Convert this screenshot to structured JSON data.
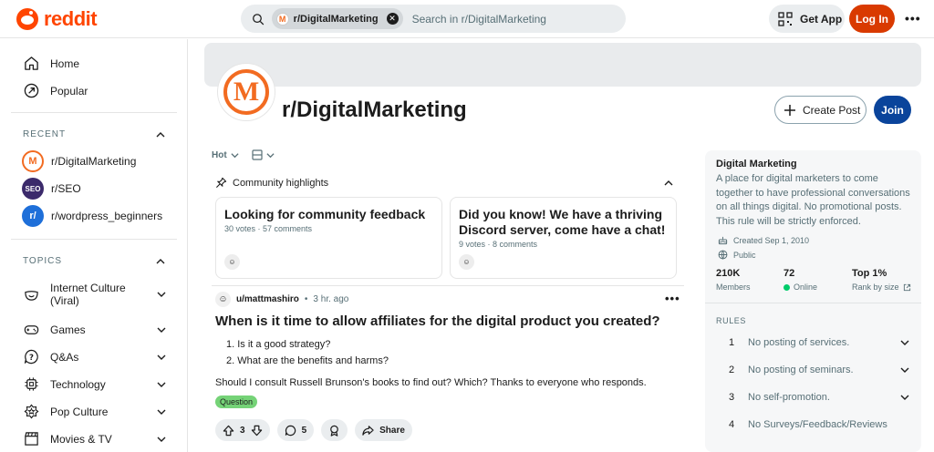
{
  "header": {
    "logo_text": "reddit",
    "search_chip": "r/DigitalMarketing",
    "search_placeholder": "Search in r/DigitalMarketing",
    "get_app_label": "Get App",
    "login_label": "Log In"
  },
  "sidebar": {
    "nav": [
      {
        "label": "Home",
        "icon": "home-icon"
      },
      {
        "label": "Popular",
        "icon": "popular-icon"
      }
    ],
    "recent_heading": "RECENT",
    "recent": [
      {
        "label": "r/DigitalMarketing",
        "avatar": "M"
      },
      {
        "label": "r/SEO",
        "avatar": "SEO"
      },
      {
        "label": "r/wordpress_beginners",
        "avatar": "r/"
      }
    ],
    "topics_heading": "TOPICS",
    "topics": [
      {
        "label": "Internet Culture (Viral)",
        "icon": "smile-icon"
      },
      {
        "label": "Games",
        "icon": "gamepad-icon"
      },
      {
        "label": "Q&As",
        "icon": "question-icon"
      },
      {
        "label": "Technology",
        "icon": "chip-icon"
      },
      {
        "label": "Pop Culture",
        "icon": "star-badge-icon"
      },
      {
        "label": "Movies & TV",
        "icon": "clapperboard-icon"
      }
    ]
  },
  "community": {
    "name": "r/DigitalMarketing",
    "avatar_letter": "M",
    "create_post_label": "Create Post",
    "join_label": "Join"
  },
  "feed": {
    "sort_label": "Hot",
    "highlights_heading": "Community highlights",
    "highlights": [
      {
        "title": "Looking for community feedback",
        "meta": "30 votes · 57 comments"
      },
      {
        "title": "Did you know! We have a thriving Discord server, come have a chat!",
        "meta": "9 votes · 8 comments"
      }
    ],
    "post": {
      "author": "u/mattmashiro",
      "time": "3 hr. ago",
      "title": "When is it time to allow affiliates for the digital product you created?",
      "list": [
        "1. Is it a good strategy?",
        "2. What are the benefits and harms?"
      ],
      "body": "Should I consult Russell Brunson's books to find out? Which? Thanks to everyone who responds.",
      "flair": "Question",
      "votes": "3",
      "comments": "5",
      "share_label": "Share"
    }
  },
  "about": {
    "title": "Digital Marketing",
    "description": "A place for digital marketers to come together to have professional conversations on all things digital. No promotional posts. This rule will be strictly enforced.",
    "created": "Created Sep 1, 2010",
    "visibility": "Public",
    "members_count": "210K",
    "members_label": "Members",
    "online_count": "72",
    "online_label": "Online",
    "rank": "Top 1%",
    "rank_label": "Rank by size",
    "rules_heading": "RULES",
    "rules": [
      {
        "num": "1",
        "text": "No posting of services."
      },
      {
        "num": "2",
        "text": "No posting of seminars."
      },
      {
        "num": "3",
        "text": "No self-promotion."
      },
      {
        "num": "4",
        "text": "No Surveys/Feedback/Reviews"
      }
    ]
  },
  "colors": {
    "brand": "#ff4500",
    "login_bg": "#d93a00",
    "join_bg": "#0a449b",
    "flair_bg": "#75d377"
  }
}
